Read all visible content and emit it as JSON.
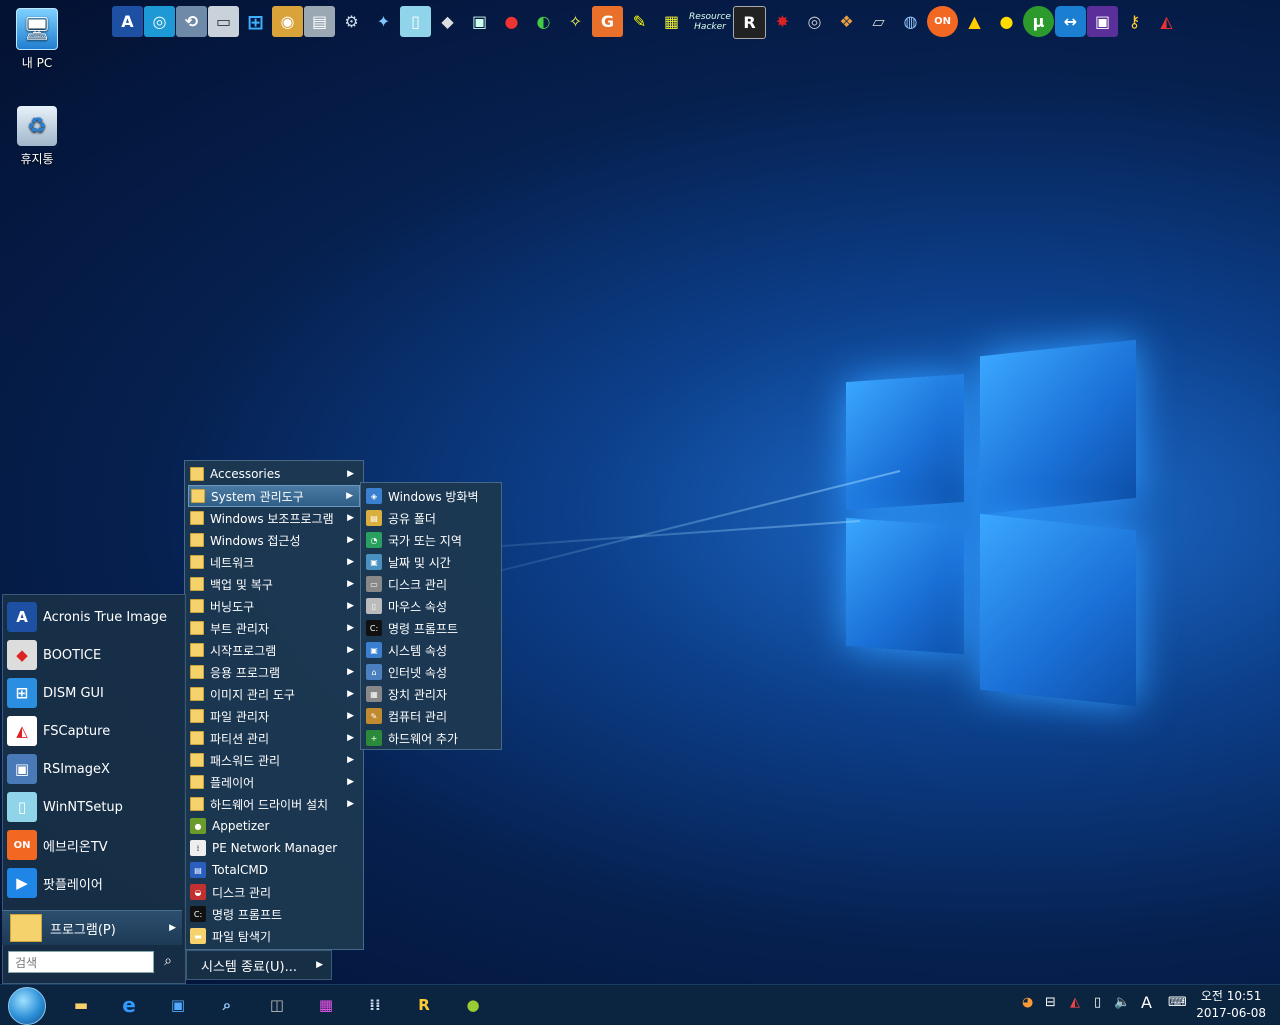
{
  "desktop": {
    "icons": [
      {
        "label": "내 PC",
        "icon": "computer-icon"
      },
      {
        "label": "휴지통",
        "icon": "recycle-bin-icon"
      }
    ]
  },
  "quickbar": {
    "resource_hacker_label": "Resource Hacker",
    "r_label": "R",
    "a_label": "A",
    "on_label": "ON"
  },
  "start_menu": {
    "items": [
      {
        "label": "Acronis True Image",
        "icon": "acronis-icon"
      },
      {
        "label": "BOOTICE",
        "icon": "bootice-icon"
      },
      {
        "label": "DISM GUI",
        "icon": "dism-icon"
      },
      {
        "label": "FSCapture",
        "icon": "fscapture-icon"
      },
      {
        "label": "RSImageX",
        "icon": "rsimagex-icon"
      },
      {
        "label": "WinNTSetup",
        "icon": "winntsetup-icon"
      },
      {
        "label": "에브리온TV",
        "icon": "everyon-tv-icon"
      },
      {
        "label": "팟플레이어",
        "icon": "potplayer-icon"
      }
    ],
    "programs_label": "프로그램(P)",
    "search_placeholder": "검색",
    "shutdown_label": "시스템 종료(U)..."
  },
  "programs_menu": {
    "folders": [
      "Accessories",
      "System 관리도구",
      "Windows 보조프로그램",
      "Windows 접근성",
      "네트워크",
      "백업 및 복구",
      "버닝도구",
      "부트 관리자",
      "시작프로그램",
      "응용 프로그램",
      "이미지 관리 도구",
      "파일 관리자",
      "파티션 관리",
      "패스워드 관리",
      "플레이어",
      "하드웨어 드라이버 설치"
    ],
    "apps": [
      {
        "label": "Appetizer",
        "icon": "appetizer-icon"
      },
      {
        "label": "PE Network Manager",
        "icon": "network-icon"
      },
      {
        "label": "TotalCMD",
        "icon": "totalcmd-icon"
      },
      {
        "label": "디스크 관리",
        "icon": "disk-management-icon"
      },
      {
        "label": "명령 프롬프트",
        "icon": "cmd-icon"
      },
      {
        "label": "파일 탐색기",
        "icon": "folder-icon"
      }
    ]
  },
  "system_tools_menu": {
    "items": [
      {
        "label": "Windows 방화벽",
        "icon": "firewall-icon"
      },
      {
        "label": "공유 폴더",
        "icon": "shared-folder-icon"
      },
      {
        "label": "국가 또는 지역",
        "icon": "region-icon"
      },
      {
        "label": "날짜 및 시간",
        "icon": "datetime-icon"
      },
      {
        "label": "디스크 관리",
        "icon": "disk-icon"
      },
      {
        "label": "마우스 속성",
        "icon": "mouse-icon"
      },
      {
        "label": "명령 프롬프트",
        "icon": "cmd-icon"
      },
      {
        "label": "시스템 속성",
        "icon": "system-icon"
      },
      {
        "label": "인터넷 속성",
        "icon": "internet-icon"
      },
      {
        "label": "장치 관리자",
        "icon": "device-manager-icon"
      },
      {
        "label": "컴퓨터 관리",
        "icon": "computer-management-icon"
      },
      {
        "label": "하드웨어 추가",
        "icon": "add-hardware-icon"
      }
    ]
  },
  "taskbar": {
    "ime_label": "A",
    "clock_time": "오전 10:51",
    "clock_date": "2017-06-08"
  }
}
